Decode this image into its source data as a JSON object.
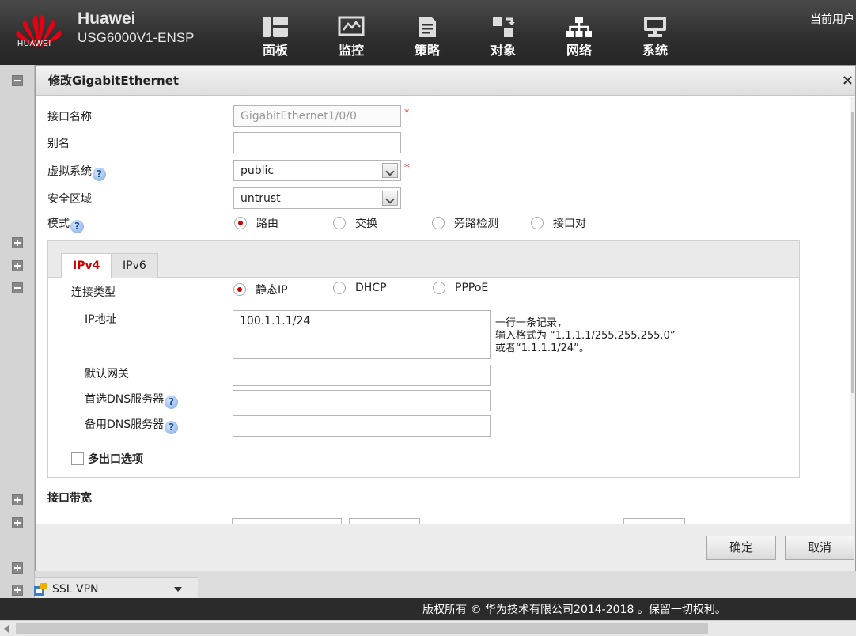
{
  "header": {
    "logo_text": "HUAWEI",
    "brand_name": "Huawei",
    "model": "USG6000V1-ENSP",
    "nav": [
      {
        "label": "面板",
        "icon": "dashboard-icon"
      },
      {
        "label": "监控",
        "icon": "monitor-icon"
      },
      {
        "label": "策略",
        "icon": "policy-icon"
      },
      {
        "label": "对象",
        "icon": "object-icon"
      },
      {
        "label": "网络",
        "icon": "network-icon"
      },
      {
        "label": "系统",
        "icon": "system-icon"
      }
    ],
    "current_user_label": "当前用户"
  },
  "dialog": {
    "title": "修改GigabitEthernet",
    "close": "×",
    "fields": {
      "interface_name": {
        "label": "接口名称",
        "value": "GigabitEthernet1/0/0",
        "required": "*"
      },
      "alias": {
        "label": "别名",
        "value": ""
      },
      "vsys": {
        "label": "虚拟系统",
        "value": "public",
        "required": "*"
      },
      "zone": {
        "label": "安全区域",
        "value": "untrust"
      },
      "mode": {
        "label": "模式",
        "options": [
          "路由",
          "交换",
          "旁路检测",
          "接口对"
        ],
        "selected": "路由"
      }
    },
    "help_glyph": "?",
    "tabs": [
      "IPv4",
      "IPv6"
    ],
    "active_tab": "IPv4",
    "ipv4": {
      "conn_type_label": "连接类型",
      "conn_options": [
        "静态IP",
        "DHCP",
        "PPPoE"
      ],
      "conn_selected": "静态IP",
      "ip_label": "IP地址",
      "ip_value": "100.1.1.1/24",
      "hint_line1": "一行一条记录，",
      "hint_line2": "输入格式为 “1.1.1.1/255.255.255.0”",
      "hint_line3": "或者“1.1.1.1/24”。",
      "gateway_label": "默认网关",
      "dns1_label": "首选DNS服务器",
      "dns2_label": "备用DNS服务器",
      "multi_exit_label": "多出口选项"
    },
    "bandwidth_section": "接口带宽",
    "ok_label": "确定",
    "cancel_label": "取消"
  },
  "sidebar": {
    "ssl_vpn_label": "SSL VPN"
  },
  "footer": {
    "copyright": "版权所有 © 华为技术有限公司2014-2018 。保留一切权利。"
  },
  "colors": {
    "accent_red": "#cc0000",
    "header_bg": "#2e2e2e"
  }
}
